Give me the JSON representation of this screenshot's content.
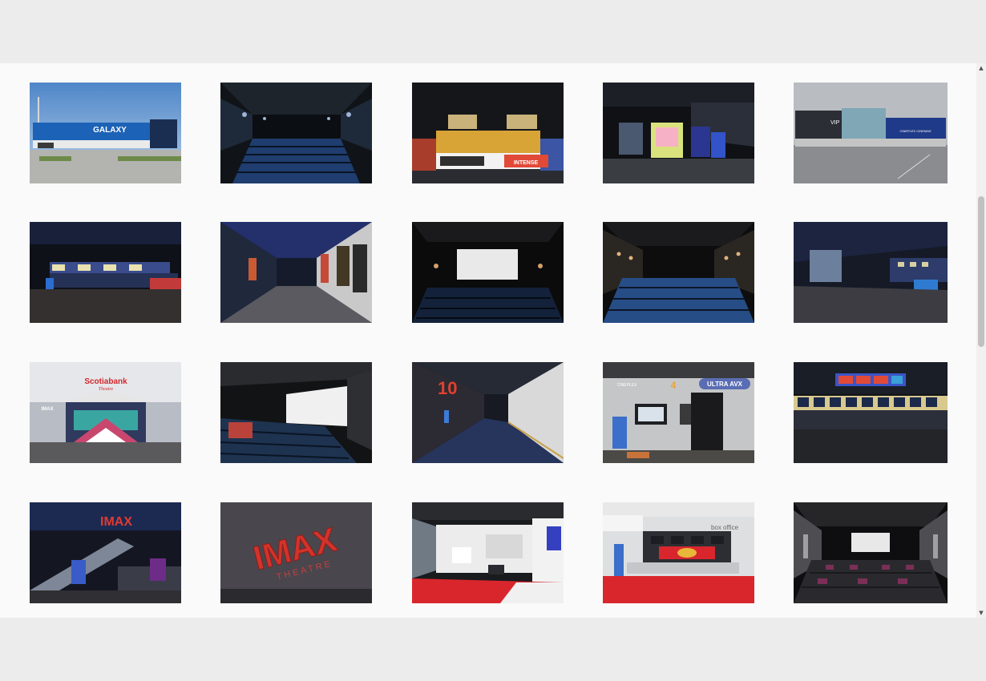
{
  "gallery": {
    "photos": [
      {
        "subject": "galaxy-exterior",
        "signage": "GALAXY"
      },
      {
        "subject": "auditorium-blue-seats"
      },
      {
        "subject": "concession-stand",
        "signage": "INTENSE"
      },
      {
        "subject": "arcade-lobby"
      },
      {
        "subject": "cineplex-vip-exterior",
        "signage": "VIP",
        "signage2": "CINEPLEX CINEMAS"
      },
      {
        "subject": "lobby-concession-wide"
      },
      {
        "subject": "hallway-posters"
      },
      {
        "subject": "auditorium-screen"
      },
      {
        "subject": "auditorium-seats-lights"
      },
      {
        "subject": "lobby-blue-lights"
      },
      {
        "subject": "scotiabank-theatre-exterior",
        "signage": "Scotiabank",
        "signage2": "Theatre",
        "signage3": "IMAX"
      },
      {
        "subject": "auditorium-side-view"
      },
      {
        "subject": "red-hallway",
        "signage": "10"
      },
      {
        "subject": "ultraavx-entrance",
        "signage": "4",
        "signage2": "ULTRA AVX",
        "signage3": "CINEPLEX"
      },
      {
        "subject": "concession-screens"
      },
      {
        "subject": "imax-escalator-lobby",
        "signage": "IMAX"
      },
      {
        "subject": "imax-theatre-sign",
        "signage": "IMAX",
        "signage2": "THEATRE"
      },
      {
        "subject": "white-lobby-red-floor"
      },
      {
        "subject": "box-office-red",
        "signage": "box office"
      },
      {
        "subject": "vip-auditorium-recliners"
      }
    ]
  },
  "colors": {
    "page_background": "#ececec",
    "panel_background": "#fafafa",
    "scroll_track": "#f1f1f1",
    "scroll_thumb": "#c1c1c1"
  },
  "scrollbar": {
    "up_icon": "▲",
    "down_icon": "▼"
  }
}
